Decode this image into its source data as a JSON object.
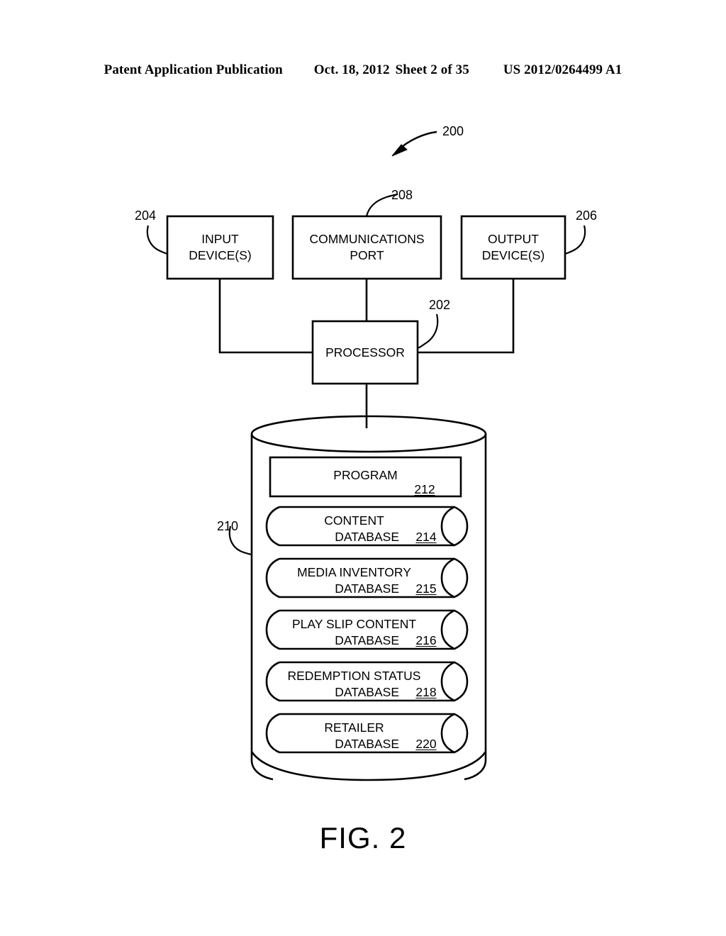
{
  "header": {
    "publication": "Patent Application Publication",
    "date": "Oct. 18, 2012",
    "sheet": "Sheet 2 of 35",
    "patent_number": "US 2012/0264499 A1"
  },
  "figure": {
    "caption": "FIG. 2",
    "system_ref": "200",
    "top_boxes": [
      {
        "id": "input-devices",
        "line1": "INPUT",
        "line2": "DEVICE(S)",
        "ref": "204"
      },
      {
        "id": "communications-port",
        "line1": "COMMUNICATIONS",
        "line2": "PORT",
        "ref": "208"
      },
      {
        "id": "output-devices",
        "line1": "OUTPUT",
        "line2": "DEVICE(S)",
        "ref": "206"
      }
    ],
    "processor": {
      "label": "PROCESSOR",
      "ref": "202"
    },
    "storage": {
      "ref": "210",
      "program": {
        "label": "PROGRAM",
        "ref": "212"
      },
      "databases": [
        {
          "line1": "CONTENT",
          "line2": "DATABASE",
          "ref": "214"
        },
        {
          "line1": "MEDIA INVENTORY",
          "line2": "DATABASE",
          "ref": "215"
        },
        {
          "line1": "PLAY SLIP CONTENT",
          "line2": "DATABASE",
          "ref": "216"
        },
        {
          "line1": "REDEMPTION STATUS",
          "line2": "DATABASE",
          "ref": "218"
        },
        {
          "line1": "RETAILER",
          "line2": "DATABASE",
          "ref": "220"
        }
      ]
    }
  },
  "colors": {
    "ink": "#000000",
    "paper": "#ffffff"
  }
}
